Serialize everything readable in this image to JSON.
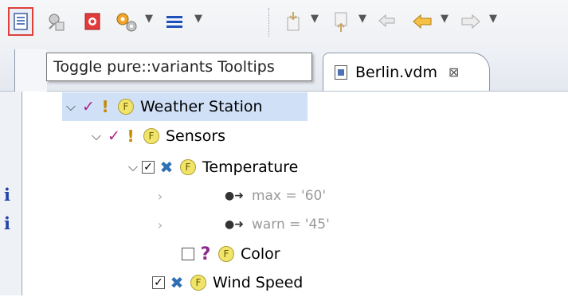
{
  "toolbar": {
    "items": [
      {
        "icon": "toggle-tooltips-icon"
      },
      {
        "icon": "model-icon"
      },
      {
        "icon": "red-marker-icon"
      },
      {
        "icon": "gears-icon"
      },
      {
        "icon": "list-icon"
      },
      {
        "icon": "import-icon"
      },
      {
        "icon": "export-icon"
      },
      {
        "icon": "back-icon"
      },
      {
        "icon": "arrow-left-icon"
      },
      {
        "icon": "arrow-right-icon"
      }
    ],
    "colors": {
      "highlight_border": "#e0403a",
      "list_blue": "#1f4fbf",
      "arrow_orange": "#f0a21a"
    }
  },
  "tooltip": {
    "text": "Toggle pure::variants Tooltips"
  },
  "tabs": [
    {
      "label": "Berlin.vdm",
      "close": "⊠"
    }
  ],
  "tree": {
    "rows": [
      {
        "label": "Weather Station",
        "selected": true
      },
      {
        "label": "Sensors"
      },
      {
        "label": "Temperature"
      },
      {
        "attr": "max = '60'"
      },
      {
        "attr": "warn = '45'"
      },
      {
        "label": "Color"
      },
      {
        "label": "Wind Speed"
      }
    ],
    "feature_badge": "F",
    "colors": {
      "selection": "#cfe0f7",
      "check": "#b0208a",
      "exclamation": "#c58a00",
      "cross": "#2f6fb3",
      "info": "#2243a8"
    }
  },
  "gutter": {
    "info_marks": [
      "i",
      "i"
    ]
  }
}
